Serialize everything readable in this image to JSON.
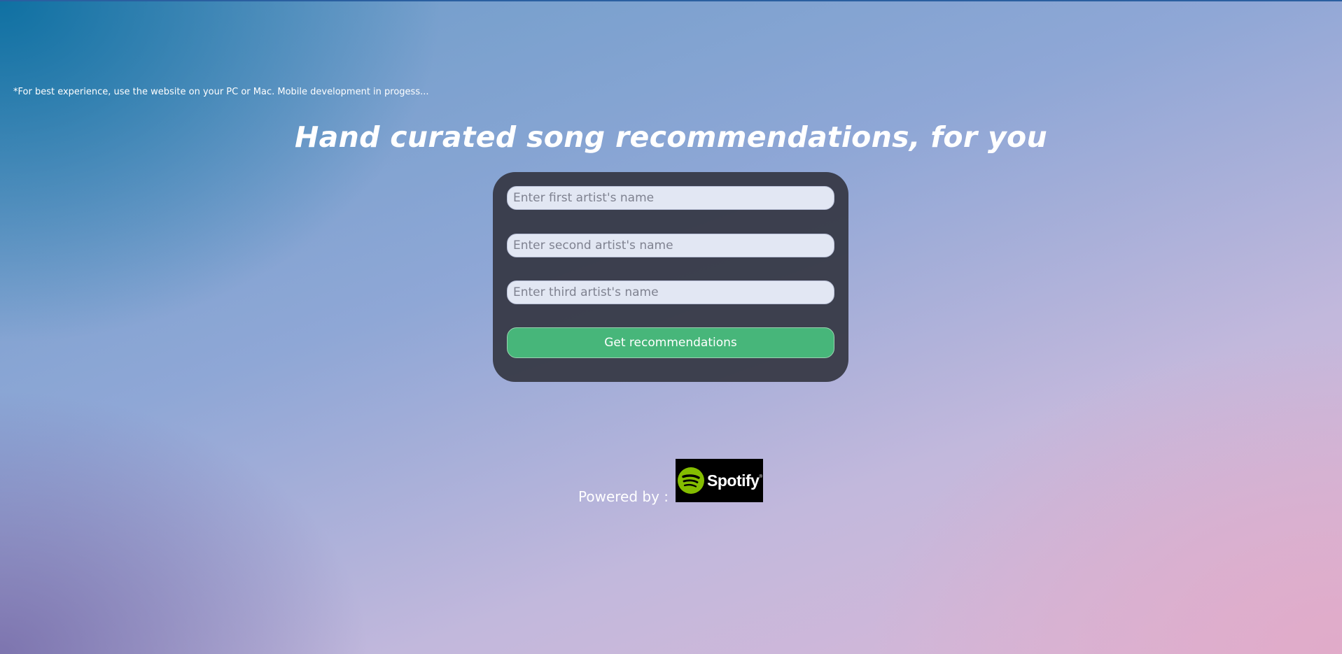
{
  "notice": "*For best experience, use the website on your PC or Mac. Mobile development in progess...",
  "headline": "Hand curated song recommendations, for you",
  "form": {
    "first_placeholder": "Enter first artist's name",
    "second_placeholder": "Enter second artist's name",
    "third_placeholder": "Enter third artist's name",
    "first_value": "",
    "second_value": "",
    "third_value": "",
    "submit_label": "Get recommendations"
  },
  "footer": {
    "powered_by": "Powered by :",
    "logo_icon": "spotify-logo",
    "logo_text": "Spotify"
  },
  "colors": {
    "card": "#343642",
    "button": "#47b67a",
    "input": "#e2e7f3",
    "spotify_green": "#1ed760"
  }
}
